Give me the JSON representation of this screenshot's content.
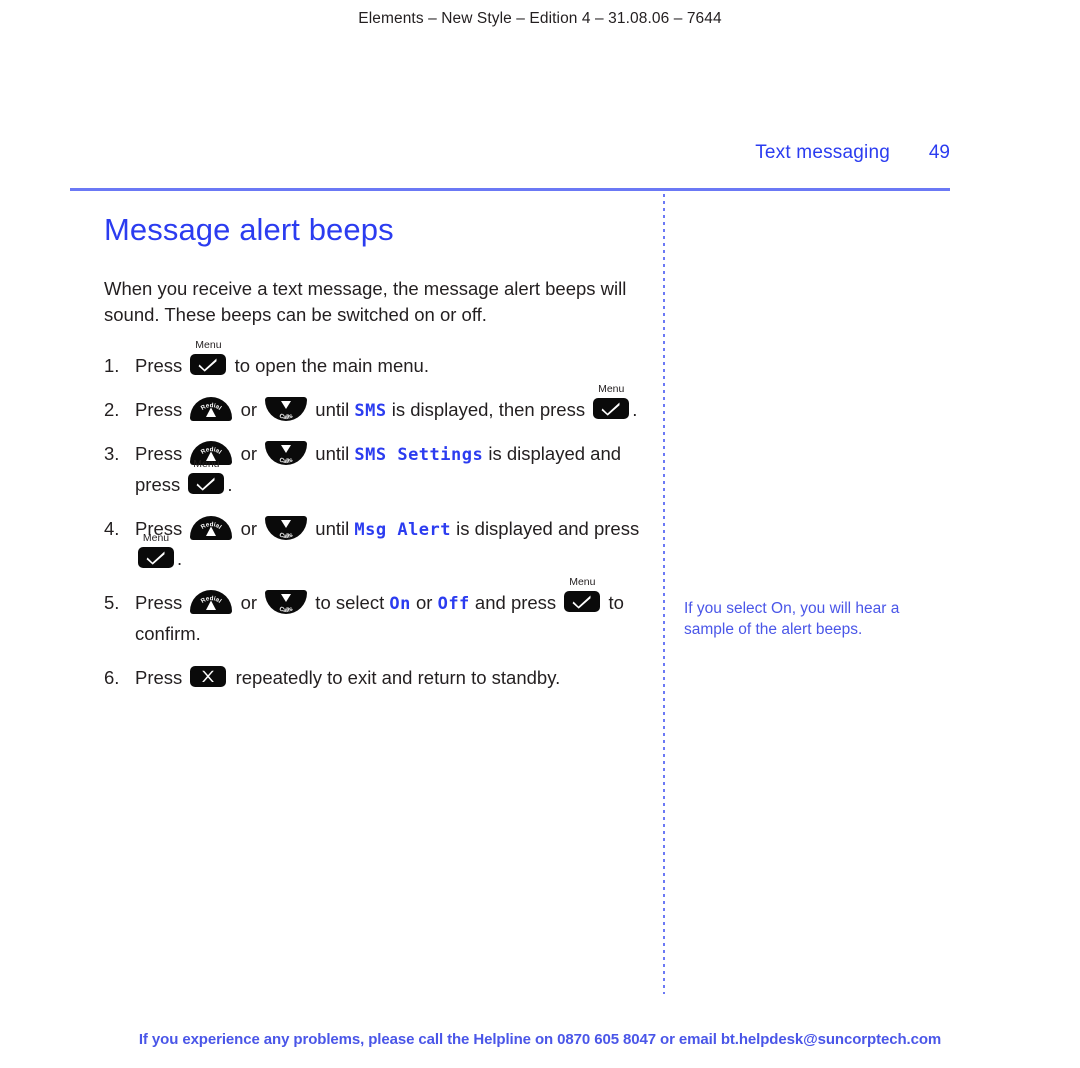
{
  "page_header": "Elements – New Style – Edition 4 – 31.08.06 – 7644",
  "running_head": {
    "title": "Text messaging",
    "page_number": "49"
  },
  "main": {
    "title": "Message alert beeps",
    "intro": "When you receive a text message, the message alert beeps will sound. These beeps can be switched on or off.",
    "steps": [
      {
        "number": "1.",
        "parts": [
          {
            "type": "text",
            "value": "Press "
          },
          {
            "type": "key",
            "key": "menu",
            "caption": "Menu"
          },
          {
            "type": "text",
            "value": " to open the main menu."
          }
        ]
      },
      {
        "number": "2.",
        "parts": [
          {
            "type": "text",
            "value": "Press "
          },
          {
            "type": "key",
            "key": "up",
            "caption": "Redial"
          },
          {
            "type": "text",
            "value": " or "
          },
          {
            "type": "key",
            "key": "down",
            "caption": "Calls"
          },
          {
            "type": "text",
            "value": " until "
          },
          {
            "type": "lcd",
            "value": "SMS"
          },
          {
            "type": "text",
            "value": " is displayed, then press "
          },
          {
            "type": "key",
            "key": "menu",
            "caption": "Menu"
          },
          {
            "type": "text",
            "value": "."
          }
        ]
      },
      {
        "number": "3.",
        "parts": [
          {
            "type": "text",
            "value": "Press "
          },
          {
            "type": "key",
            "key": "up",
            "caption": "Redial"
          },
          {
            "type": "text",
            "value": " or "
          },
          {
            "type": "key",
            "key": "down",
            "caption": "Calls"
          },
          {
            "type": "text",
            "value": " until "
          },
          {
            "type": "lcd",
            "value": "SMS Settings"
          },
          {
            "type": "text",
            "value": " is displayed and press "
          },
          {
            "type": "key",
            "key": "menu",
            "caption": "Menu"
          },
          {
            "type": "text",
            "value": "."
          }
        ]
      },
      {
        "number": "4.",
        "parts": [
          {
            "type": "text",
            "value": "Press "
          },
          {
            "type": "key",
            "key": "up",
            "caption": "Redial"
          },
          {
            "type": "text",
            "value": " or "
          },
          {
            "type": "key",
            "key": "down",
            "caption": "Calls"
          },
          {
            "type": "text",
            "value": " until "
          },
          {
            "type": "lcd",
            "value": "Msg Alert"
          },
          {
            "type": "text",
            "value": " is displayed and press "
          },
          {
            "type": "key",
            "key": "menu",
            "caption": "Menu"
          },
          {
            "type": "text",
            "value": "."
          }
        ]
      },
      {
        "number": "5.",
        "parts": [
          {
            "type": "text",
            "value": "Press "
          },
          {
            "type": "key",
            "key": "up",
            "caption": "Redial"
          },
          {
            "type": "text",
            "value": " or "
          },
          {
            "type": "key",
            "key": "down",
            "caption": "Calls"
          },
          {
            "type": "text",
            "value": " to select "
          },
          {
            "type": "lcd",
            "value": "On"
          },
          {
            "type": "text",
            "value": " or "
          },
          {
            "type": "lcd",
            "value": "Off"
          },
          {
            "type": "text",
            "value": " and press "
          },
          {
            "type": "key",
            "key": "menu",
            "caption": "Menu"
          },
          {
            "type": "text",
            "value": " to confirm."
          }
        ]
      },
      {
        "number": "6.",
        "parts": [
          {
            "type": "text",
            "value": "Press "
          },
          {
            "type": "key",
            "key": "cancel",
            "caption": ""
          },
          {
            "type": "text",
            "value": " repeatedly to exit and return to standby."
          }
        ]
      }
    ]
  },
  "sidebar": {
    "note": "If you select On, you will hear a sample of the alert beeps."
  },
  "footer": "If you experience any problems, please call the Helpline on 0870 605 8047 or email bt.helpdesk@suncorptech.com",
  "colors": {
    "brand_blue": "#2b3cf0",
    "rule_blue": "#6b79f5",
    "note_blue": "#4a56e8",
    "key_black": "#0a0a0a",
    "body_text": "#231f20"
  }
}
